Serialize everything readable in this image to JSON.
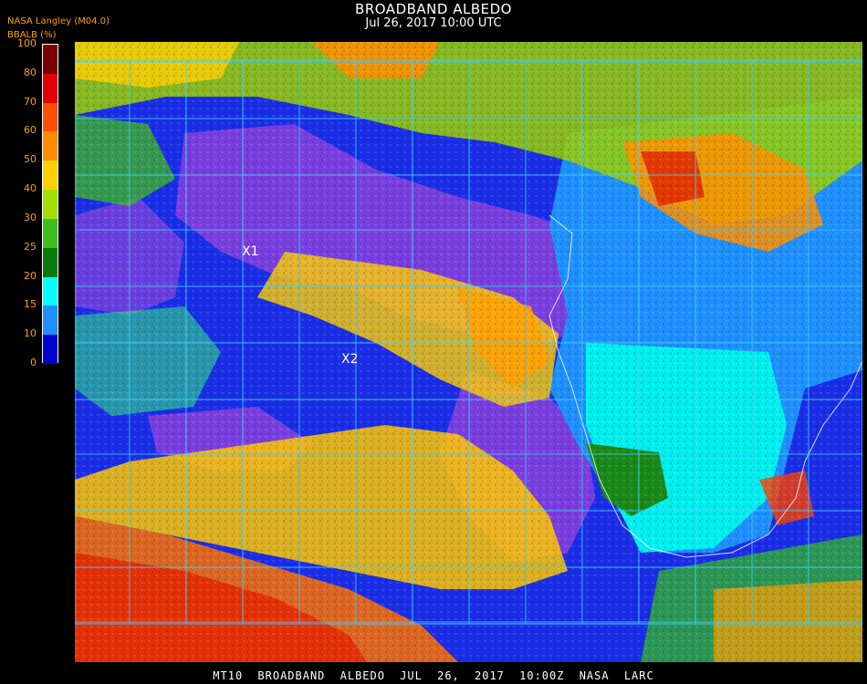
{
  "header": {
    "title": "BROADBAND ALBEDO",
    "datetime": "Jul 26, 2017 10:00 UTC"
  },
  "legend": {
    "source": "NASA Langley (M04.0)",
    "param": "BBALB (%)",
    "ticks": [
      "100",
      "80",
      "70",
      "60",
      "50",
      "40",
      "30",
      "25",
      "20",
      "15",
      "10",
      "0"
    ],
    "colors": [
      "#7a0000",
      "#e00000",
      "#ff5000",
      "#ff8c00",
      "#ffd000",
      "#a0e000",
      "#3fbf1f",
      "#0a7a0a",
      "#00ffff",
      "#1e90ff",
      "#0000d0",
      "#8a3fe0"
    ]
  },
  "map": {
    "markers": [
      {
        "id": "x1",
        "label": "X1"
      },
      {
        "id": "x2",
        "label": "X2"
      }
    ],
    "grid_color": "#40d0ff"
  },
  "footer": {
    "text": "MT10  BROADBAND ALBEDO   JUL 26, 2017 10:00Z   NASA LARC"
  }
}
